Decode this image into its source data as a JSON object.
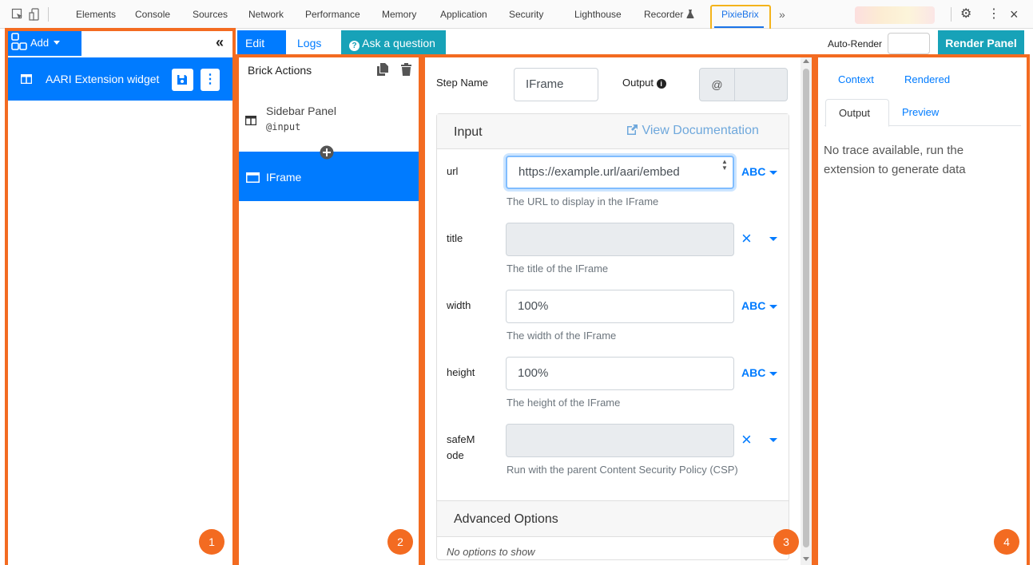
{
  "devtools": {
    "tabs": [
      "Elements",
      "Console",
      "Sources",
      "Network",
      "Performance",
      "Memory",
      "Application",
      "Security",
      "Lighthouse",
      "Recorder",
      "PixieBrix"
    ],
    "more": "»",
    "settings": "⚙",
    "menu": "⋮",
    "close": "×"
  },
  "toolbar": {
    "add": "Add",
    "collapse": "«",
    "edit": "Edit",
    "logs": "Logs",
    "ask": "Ask a question",
    "auto_render": "Auto-Render",
    "render_panel": "Render Panel"
  },
  "sidebar": {
    "extension_name": "AARI Extension widget"
  },
  "brick_actions": {
    "title": "Brick Actions",
    "items": [
      {
        "name": "Sidebar Panel",
        "sub": "@input"
      },
      {
        "name": "IFrame",
        "sub": ""
      }
    ]
  },
  "editor": {
    "step_name_label": "Step Name",
    "step_name_value": "IFrame",
    "output_label": "Output",
    "output_symbol": "@",
    "input_title": "Input",
    "view_docs": "View Documentation",
    "abc": "ABC",
    "fields": [
      {
        "name": "url",
        "value": "https://example.url/aari/embed",
        "help": "The URL to display in the IFrame",
        "type": "ABC"
      },
      {
        "name": "title",
        "value": "",
        "help": "The title of the IFrame",
        "type": "×"
      },
      {
        "name": "width",
        "value": "100%",
        "help": "The width of the IFrame",
        "type": "ABC"
      },
      {
        "name": "height",
        "value": "100%",
        "help": "The height of the IFrame",
        "type": "ABC"
      },
      {
        "name": "safeM ode",
        "name_line1": "safeM",
        "name_line2": "ode",
        "value": "",
        "help": "Run with the parent Content Security Policy (CSP)",
        "type": "×"
      }
    ],
    "advanced_title": "Advanced Options",
    "advanced_empty": "No options to show"
  },
  "preview": {
    "tabs_top": [
      "Context",
      "Rendered"
    ],
    "tabs_bottom": [
      "Output",
      "Preview"
    ],
    "message": "No trace available, run the extension to generate data"
  },
  "badges": [
    "1",
    "2",
    "3",
    "4"
  ],
  "colors": {
    "accent": "#007bff",
    "teal": "#17a2b8",
    "orange": "#f36b21",
    "highlight": "#f4b31a"
  }
}
